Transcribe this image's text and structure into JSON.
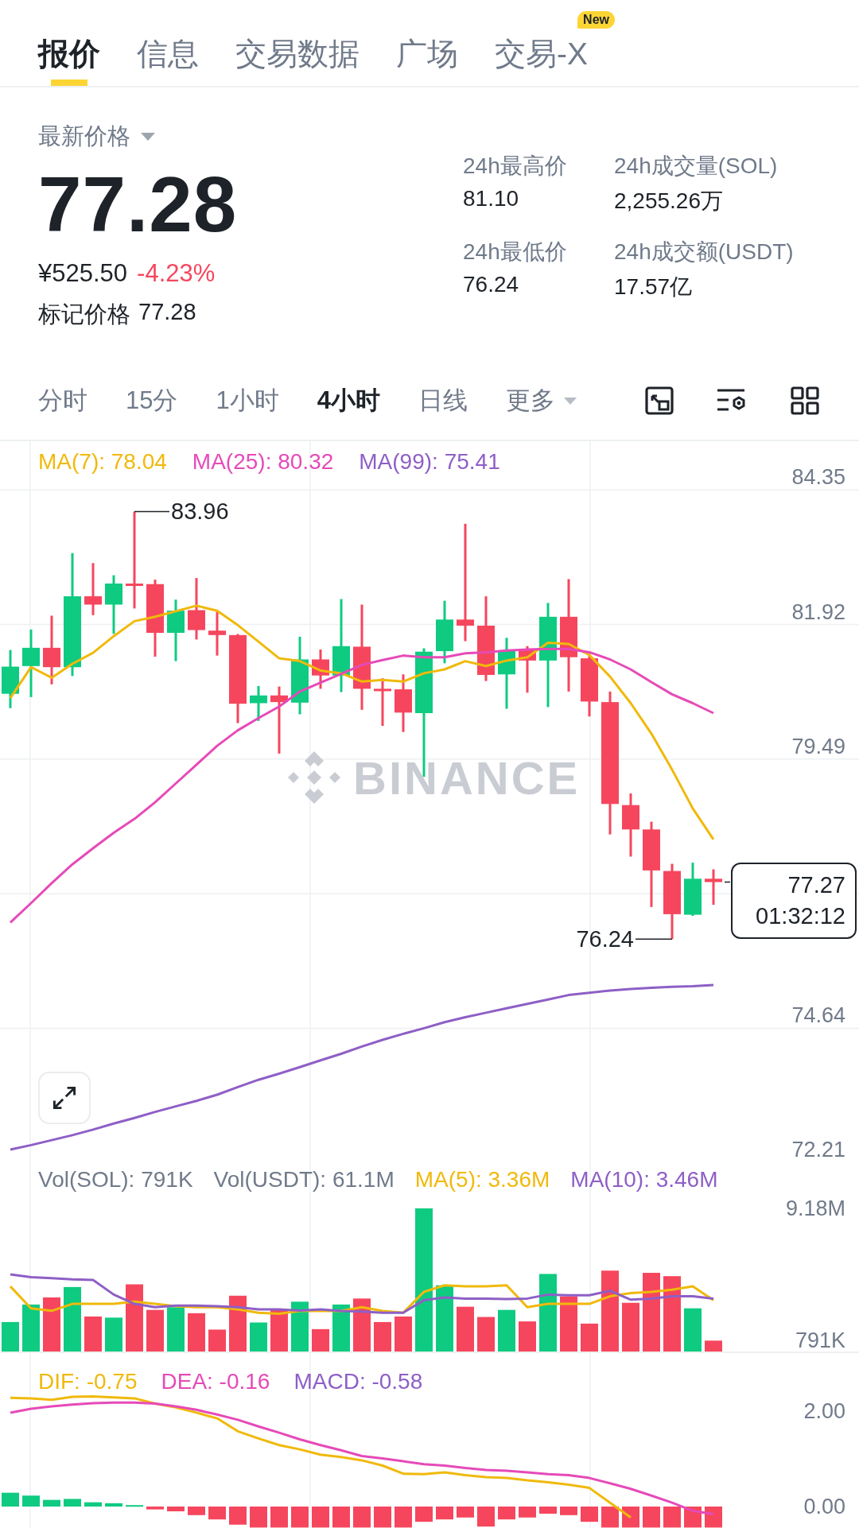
{
  "tabs": [
    {
      "label": "报价",
      "selected": true
    },
    {
      "label": "信息",
      "selected": false
    },
    {
      "label": "交易数据",
      "selected": false
    },
    {
      "label": "广场",
      "selected": false
    },
    {
      "label": "交易-X",
      "selected": false,
      "badge": "New"
    }
  ],
  "price_header": {
    "label": "最新价格",
    "last_price": "77.28",
    "fiat_price": "¥525.50",
    "change": "-4.23%",
    "mark_label": "标记价格",
    "mark_price": "77.28"
  },
  "stats": [
    {
      "label": "24h最高价",
      "value": "81.10"
    },
    {
      "label": "24h成交量(SOL)",
      "value": "2,255.26万"
    },
    {
      "label": "24h最低价",
      "value": "76.24"
    },
    {
      "label": "24h成交额(USDT)",
      "value": "17.57亿"
    }
  ],
  "intervals": [
    {
      "label": "分时",
      "selected": false,
      "kind": "option"
    },
    {
      "label": "15分",
      "selected": false,
      "kind": "option"
    },
    {
      "label": "1小时",
      "selected": false,
      "kind": "option"
    },
    {
      "label": "4小时",
      "selected": true,
      "kind": "option"
    },
    {
      "label": "日线",
      "selected": false,
      "kind": "option"
    },
    {
      "label": "更多",
      "selected": false,
      "kind": "menu"
    }
  ],
  "price_chart": {
    "watermark": "BINANCE",
    "high_label": "83.96",
    "low_label": "76.24",
    "last_price": "77.27",
    "countdown": "01:32:12",
    "chart_data": {
      "type": "line",
      "grid": true,
      "ylim": [
        72.21,
        85.23
      ],
      "yticks": [
        84.35,
        81.92,
        79.49,
        74.64,
        72.21
      ],
      "series": [
        {
          "name": "MA(7): 78.04",
          "color": "#f0b90b",
          "values": [
            80.59,
            81.15,
            80.96,
            81.21,
            81.41,
            81.71,
            81.98,
            82.06,
            82.16,
            82.26,
            82.17,
            81.91,
            81.61,
            81.31,
            81.26,
            81.09,
            81.04,
            80.89,
            80.92,
            80.89,
            81.04,
            81.11,
            81.26,
            81.17,
            81.27,
            81.33,
            81.59,
            81.57,
            81.37,
            80.98,
            80.5,
            79.95,
            79.3,
            78.6,
            78.04
          ]
        },
        {
          "name": "MA(25): 80.32",
          "color": "#e64ab8",
          "values": [
            76.54,
            76.89,
            77.25,
            77.59,
            77.88,
            78.16,
            78.41,
            78.71,
            79.05,
            79.39,
            79.73,
            80.01,
            80.23,
            80.44,
            80.71,
            80.87,
            81.03,
            81.19,
            81.28,
            81.36,
            81.33,
            81.33,
            81.4,
            81.42,
            81.45,
            81.47,
            81.48,
            81.48,
            81.42,
            81.29,
            81.11,
            80.88,
            80.66,
            80.5,
            80.32
          ]
        },
        {
          "name": "MA(99): 75.41",
          "color": "#8e5fc6",
          "values": [
            72.44,
            72.52,
            72.61,
            72.7,
            72.8,
            72.91,
            73.01,
            73.12,
            73.22,
            73.32,
            73.43,
            73.57,
            73.7,
            73.81,
            73.93,
            74.05,
            74.17,
            74.3,
            74.42,
            74.53,
            74.63,
            74.74,
            74.83,
            74.91,
            74.99,
            75.07,
            75.15,
            75.23,
            75.27,
            75.31,
            75.34,
            75.36,
            75.38,
            75.39,
            75.41
          ]
        }
      ]
    }
  },
  "volume_chart": {
    "sol_volume": "Vol(SOL): 791K",
    "usdt_volume": "Vol(USDT): 61.1M",
    "chart_data": {
      "type": "bar",
      "ylim": [
        0,
        12100000
      ],
      "yticks": [
        {
          "value": 9180000,
          "label": "9.18M"
        },
        {
          "value": 791000,
          "label": "791K"
        }
      ],
      "series": [
        {
          "colors": [
            "#0ecb81",
            "#0ecb81",
            "#f6465d",
            "#0ecb81",
            "#f6465d",
            "#0ecb81",
            "#f6465d",
            "#f6465d",
            "#0ecb81",
            "#f6465d",
            "#f6465d",
            "#f6465d",
            "#0ecb81",
            "#f6465d",
            "#0ecb81",
            "#f6465d",
            "#0ecb81",
            "#f6465d",
            "#f6465d",
            "#f6465d",
            "#0ecb81",
            "#0ecb81",
            "#f6465d",
            "#f6465d",
            "#0ecb81",
            "#f6465d",
            "#0ecb81",
            "#f6465d",
            "#f6465d",
            "#f6465d",
            "#f6465d",
            "#f6465d",
            "#f6465d",
            "#0ecb81",
            "#f6465d"
          ],
          "values": [
            1970000,
            3080000,
            3530000,
            4190000,
            2320000,
            2250000,
            4360000,
            2740000,
            2910000,
            2530000,
            1490000,
            3640000,
            1940000,
            2740000,
            3260000,
            1520000,
            3080000,
            3460000,
            1970000,
            2320000,
            9180000,
            4300000,
            2940000,
            2290000,
            2740000,
            2010000,
            5020000,
            3600000,
            1870000,
            5230000,
            3190000,
            5090000,
            4880000,
            2840000,
            791000
          ]
        },
        {
          "name": "MA(5): 3.36M",
          "type": "line",
          "color": "#f0b90b",
          "values": [
            4230000,
            2840000,
            2680000,
            3120000,
            3120000,
            3120000,
            3260000,
            3120000,
            2980000,
            2910000,
            2910000,
            2770000,
            2560000,
            2490000,
            2670000,
            2670000,
            2670000,
            2910000,
            2670000,
            2560000,
            3880000,
            4300000,
            4230000,
            4230000,
            4300000,
            2910000,
            3120000,
            3120000,
            3120000,
            3600000,
            3810000,
            3880000,
            4020000,
            4230000,
            3360000
          ]
        },
        {
          "name": "MA(10): 3.46M",
          "type": "line",
          "color": "#8e5fc6",
          "values": [
            4990000,
            4820000,
            4750000,
            4680000,
            4640000,
            3710000,
            3120000,
            2910000,
            3010000,
            3010000,
            2980000,
            2910000,
            2770000,
            2770000,
            2700000,
            2770000,
            2670000,
            2630000,
            2560000,
            2560000,
            3360000,
            3530000,
            3460000,
            3460000,
            3430000,
            3460000,
            3710000,
            3670000,
            3670000,
            3950000,
            3390000,
            3460000,
            3600000,
            3600000,
            3460000
          ]
        }
      ]
    }
  },
  "macd_chart": {
    "macd_reading": "MACD: -0.58",
    "chart_data": {
      "type": "line",
      "ylim": [
        -0.45,
        3.22
      ],
      "yticks": [
        {
          "value": 2,
          "label": "2.00"
        },
        {
          "value": 0,
          "label": "0.00"
        }
      ],
      "series": [
        {
          "name": "DIF: -0.75",
          "color": "#f0b90b",
          "values": [
            2.28,
            2.27,
            2.24,
            2.3,
            2.31,
            2.29,
            2.27,
            2.16,
            2.08,
            1.97,
            1.85,
            1.58,
            1.43,
            1.29,
            1.2,
            1.09,
            1.04,
            0.97,
            0.86,
            0.69,
            0.68,
            0.72,
            0.66,
            0.62,
            0.6,
            0.55,
            0.51,
            0.46,
            0.39,
            0.08,
            -0.23,
            null,
            null,
            null,
            null
          ]
        },
        {
          "name": "DEA: -0.16",
          "color": "#e64ab8",
          "values": [
            1.97,
            2.05,
            2.1,
            2.14,
            2.17,
            2.18,
            2.18,
            2.16,
            2.1,
            2.03,
            1.93,
            1.82,
            1.68,
            1.55,
            1.41,
            1.29,
            1.18,
            1.06,
            1.01,
            0.95,
            0.89,
            0.86,
            0.81,
            0.77,
            0.75,
            0.72,
            0.68,
            0.66,
            0.6,
            0.49,
            0.37,
            0.23,
            0.08,
            -0.09,
            -0.16
          ]
        },
        {
          "type": "bar",
          "colors": [
            "#0ecb81",
            "#0ecb81",
            "#0ecb81",
            "#0ecb81",
            "#0ecb81",
            "#0ecb81",
            "#0ecb81",
            "#f6465d",
            "#f6465d",
            "#f6465d",
            "#f6465d",
            "#f6465d",
            "#f6465d",
            "#f6465d",
            "#f6465d",
            "#f6465d",
            "#f6465d",
            "#f6465d",
            "#f6465d",
            "#f6465d",
            "#f6465d",
            "#f6465d",
            "#f6465d",
            "#f6465d",
            "#f6465d",
            "#f6465d",
            "#f6465d",
            "#f6465d",
            "#f6465d",
            "#f6465d",
            "#f6465d",
            "#f6465d",
            "#f6465d",
            "#f6465d",
            "#f6465d"
          ],
          "values": [
            0.29,
            0.23,
            0.14,
            0.16,
            0.09,
            0.07,
            0.03,
            -0.06,
            -0.1,
            -0.18,
            -0.27,
            -0.38,
            -0.44,
            -0.44,
            -0.44,
            -0.44,
            -0.44,
            -0.44,
            -0.44,
            -0.44,
            -0.32,
            -0.27,
            -0.23,
            -0.42,
            -0.27,
            -0.23,
            -0.15,
            -0.18,
            -0.32,
            -0.44,
            -0.44,
            -0.44,
            -0.44,
            -0.44,
            -0.44
          ]
        }
      ]
    }
  }
}
